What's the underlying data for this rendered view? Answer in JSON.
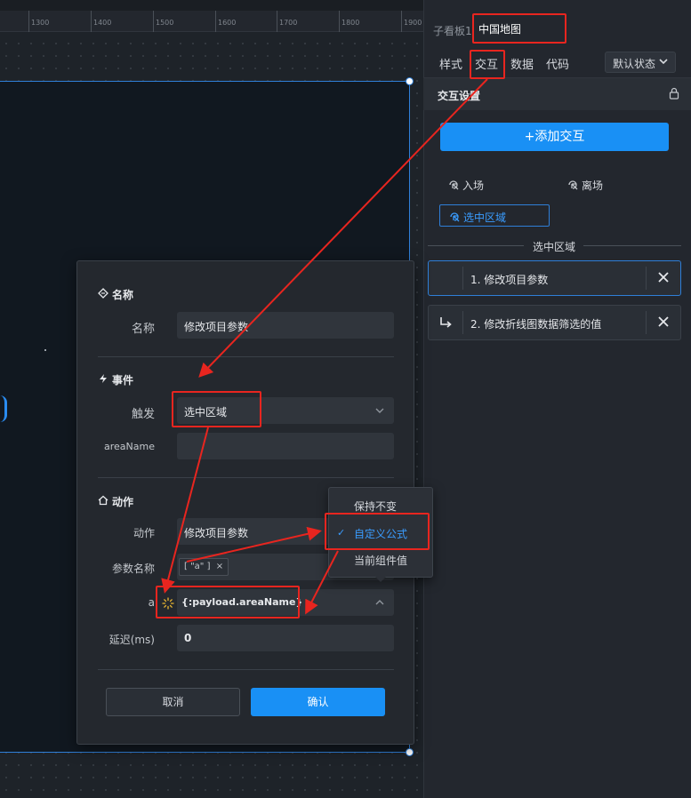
{
  "ruler": {
    "ticks": [
      "1300",
      "1400",
      "1500",
      "1600",
      "1700",
      "1800",
      "1900"
    ]
  },
  "panel": {
    "sub_label": "子看板1",
    "component_title": "中国地图",
    "tabs": [
      "样式",
      "交互",
      "数据",
      "代码"
    ],
    "active_tab": "交互",
    "state_select": "默认状态",
    "section_title": "交互设置",
    "add_button": "+添加交互",
    "events": {
      "enter": "入场",
      "leave": "离场",
      "select_area": "选中区域"
    },
    "divider_label": "选中区域",
    "actions": [
      {
        "label": "1. 修改项目参数"
      },
      {
        "label": "2. 修改折线图数据筛选的值"
      }
    ]
  },
  "modal": {
    "name_section": "名称",
    "name_label": "名称",
    "name_value": "修改项目参数",
    "event_section": "事件",
    "trigger_label": "触发",
    "trigger_value": "选中区域",
    "areaname_label": "areaName",
    "areaname_value": "",
    "action_section": "动作",
    "action_label": "动作",
    "action_value": "修改项目参数",
    "param_label": "参数名称",
    "param_tag": "[ \"a\" ]",
    "param_tag_close": "×",
    "formula_label": "a",
    "formula_value": "{:payload.areaName}",
    "delay_label": "延迟(ms)",
    "delay_value": "0",
    "cancel": "取消",
    "confirm": "确认"
  },
  "dropdown": {
    "options": [
      "保持不变",
      "自定义公式",
      "当前组件值"
    ],
    "selected": "自定义公式"
  },
  "colors": {
    "accent": "#1990f5",
    "annotation": "#e8251f",
    "selected_text": "#3a9cff"
  }
}
